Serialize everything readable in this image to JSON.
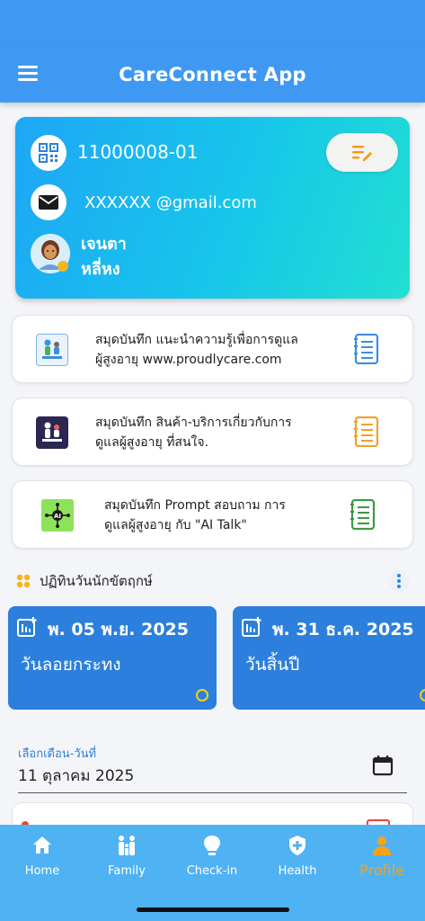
{
  "app_bar": {
    "title": "CareConnect App"
  },
  "profile": {
    "member_id": "11000008-01",
    "email": "XXXXXX @gmail.com",
    "first_name": "เจนตา",
    "last_name": "หลี่หง"
  },
  "notebooks": [
    {
      "line1": "สมุดบันทึก แนะนำความรู้เพื่อการดูแล",
      "line2": "ผู้สูงอายุ www.proudlycare.com",
      "color": "#3d8de0"
    },
    {
      "line1": "สมุดบันทึก สินค้า-บริการเกี่ยวกับการ",
      "line2": "ดูแลผู้สูงอายุ ที่สนใจ.",
      "color": "#f0a12a"
    },
    {
      "line1": "สมุดบันทึก Prompt สอบถาม การ",
      "line2": "ดูแลผู้สูงอายุ กับ \"AI Talk\"",
      "color": "#3a9a42"
    }
  ],
  "calendar_section": {
    "title": "ปฏิทินวันนักขัตฤกษ์"
  },
  "events": [
    {
      "date": "พ. 05 พ.ย. 2025",
      "name": "วันลอยกระทง"
    },
    {
      "date": "พ. 31 ธ.ค. 2025",
      "name": "วันสิ้นปี"
    }
  ],
  "date_picker": {
    "label": "เลือกเดือน-วันที่",
    "value": "11 ตุลาคม 2025"
  },
  "bottom_nav": [
    {
      "label": "Home",
      "icon": "home-icon"
    },
    {
      "label": "Family",
      "icon": "family-icon"
    },
    {
      "label": "Check-in",
      "icon": "lightbulb-icon"
    },
    {
      "label": "Health",
      "icon": "shield-plus-icon"
    },
    {
      "label": "Profile",
      "icon": "person-icon",
      "active": true
    }
  ],
  "colors": {
    "primary": "#3f99f2",
    "event_card": "#2c7fdc",
    "active_nav": "#f6a21b",
    "nav_bg": "#4fb2f3"
  }
}
